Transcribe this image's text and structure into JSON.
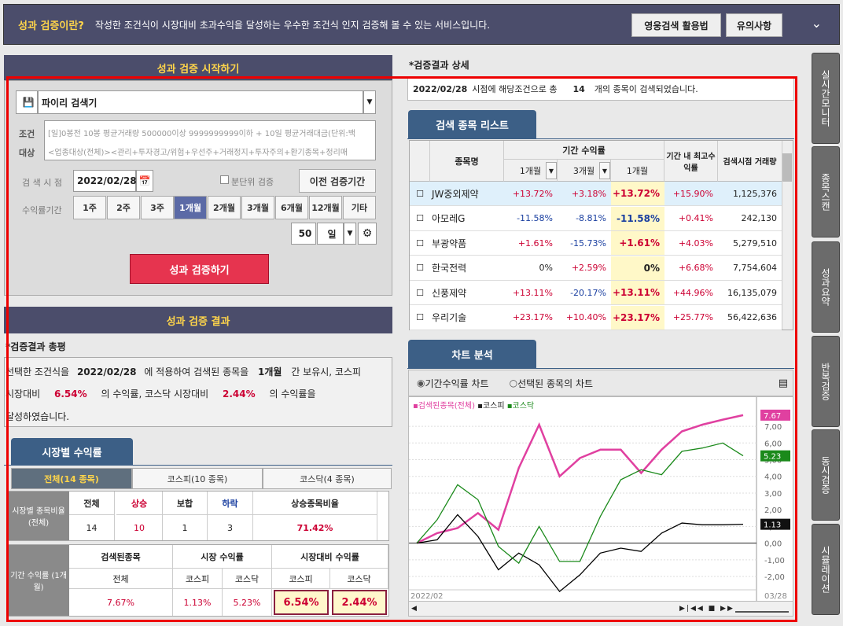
{
  "top": {
    "question": "성과 검증이란?",
    "desc": "작성한 조건식이 시장대비 초과수익을 달성하는 우수한 조건식 인지 검증해 볼 수 있는 서비스입니다.",
    "btn_guide": "영웅검색 활용법",
    "btn_notice": "유의사항"
  },
  "start": {
    "title": "성과 검증 시작하기",
    "search_name": "파이리 검색기",
    "cond_label": "조건",
    "cond_text": "[일]0봉전 10봉 평균거래량 500000이상 9999999999이하 + 10일 평균거래대금(단위:백",
    "target_label": "대상",
    "target_text": "<업종대상(전체)><관리+투자경고/위험+우선주+거래정지+투자주의+환기종목+정리매",
    "date_label": "검 색 시 점",
    "date": "2022/02/28",
    "minute_check": "분단위 검증",
    "prev_btn": "이전 검증기간",
    "period_label": "수익률기간",
    "periods": [
      "1주",
      "2주",
      "3주",
      "1개월",
      "2개월",
      "3개월",
      "6개월",
      "12개월",
      "기타"
    ],
    "days_val": "50",
    "days_unit": "일",
    "run_btn": "성과 검증하기"
  },
  "result": {
    "title": "성과 검증 결과",
    "summary_title": "*검증결과 총평",
    "line1a": "선택한 조건식을",
    "line1b": "2022/02/28",
    "line1c": "에 적용하여 검색된 종목을",
    "line1d": "1개월",
    "line1e": "간 보유시, 코스피",
    "line2a": "시장대비",
    "line2b": "6.54%",
    "line2c": "의 수익률, 코스닥 시장대비",
    "line2d": "2.44%",
    "line2e": "의 수익률을",
    "line3": "달성하였습니다."
  },
  "market": {
    "tab": "시장별 수익률",
    "subtabs": [
      "전체(14 종목)",
      "코스피(10 종목)",
      "코스닥(4 종목)"
    ],
    "ratio_label": "시장별 종목비율 (전체)",
    "ratio_heads": [
      "전체",
      "상승",
      "보합",
      "하락",
      "상승종목비율"
    ],
    "ratio_vals": [
      "14",
      "10",
      "1",
      "3",
      "71.42%"
    ],
    "ret_label": "기간 수익률 (1개월)",
    "ret_h1": [
      "검색된종목",
      "시장 수익률",
      "시장대비 수익률"
    ],
    "ret_h2": [
      "전체",
      "코스피",
      "코스닥",
      "코스피",
      "코스닥"
    ],
    "ret_vals": [
      "7.67%",
      "1.13%",
      "5.23%",
      "6.54%",
      "2.44%"
    ]
  },
  "detail": {
    "title": "*검증결과 상세",
    "date": "2022/02/28",
    "t1": "시점에 해당조건으로 총",
    "count": "14",
    "t2": "개의 종목이 검색되었습니다."
  },
  "list": {
    "tab": "검색 종목 리스트",
    "h_name": "종목명",
    "h_period": "기간 수익률",
    "h_max": "기간 내 최고수익률",
    "h_vol": "검색시점 거래량",
    "sub": [
      "1개월",
      "3개월",
      "1개월"
    ],
    "rows": [
      {
        "name": "JW중외제약",
        "a": "+13.72%",
        "b": "+3.18%",
        "c": "+13.72%",
        "d": "+15.90%",
        "v": "1,125,376"
      },
      {
        "name": "아모레G",
        "a": "-11.58%",
        "b": "-8.81%",
        "c": "-11.58%",
        "d": "+0.41%",
        "v": "242,130"
      },
      {
        "name": "부광약품",
        "a": "+1.61%",
        "b": "-15.73%",
        "c": "+1.61%",
        "d": "+4.03%",
        "v": "5,279,510"
      },
      {
        "name": "한국전력",
        "a": "0%",
        "b": "+2.59%",
        "c": "0%",
        "d": "+6.68%",
        "v": "7,754,604"
      },
      {
        "name": "신풍제약",
        "a": "+13.11%",
        "b": "-20.17%",
        "c": "+13.11%",
        "d": "+44.96%",
        "v": "16,135,079"
      },
      {
        "name": "우리기술",
        "a": "+23.17%",
        "b": "+10.40%",
        "c": "+23.17%",
        "d": "+25.77%",
        "v": "56,422,636"
      }
    ]
  },
  "chart": {
    "tab": "차트 분석",
    "radio1": "기간수익률 차트",
    "radio2": "선택된 종목의 차트",
    "legend": [
      "검색된종목(전체)",
      "코스피",
      "코스닥"
    ],
    "x_start": "2022/02",
    "x_end": "03/28",
    "ticks": [
      "7,00",
      "6,00",
      "5,00",
      "4,00",
      "3,00",
      "2,00",
      "1,00",
      "0,00",
      "-1,00",
      "-2,00"
    ],
    "labels": [
      "7.67",
      "5.23",
      "1.13"
    ]
  },
  "chart_data": {
    "type": "line",
    "ylim": [
      -2.8,
      7.9
    ],
    "series": [
      {
        "name": "검색된종목(전체)",
        "color": "#e040a0",
        "values": [
          0,
          0.6,
          0.9,
          1.8,
          0.8,
          4.5,
          7.1,
          4.0,
          5.1,
          5.6,
          5.6,
          4.2,
          5.6,
          6.7,
          7.1,
          7.4,
          7.67
        ]
      },
      {
        "name": "코스피",
        "color": "#000000",
        "values": [
          0,
          0.2,
          1.7,
          0.4,
          -1.6,
          -0.6,
          -1.3,
          -2.9,
          -1.9,
          -0.6,
          -0.3,
          -0.5,
          0.6,
          1.2,
          1.1,
          1.1,
          1.13
        ]
      },
      {
        "name": "코스닥",
        "color": "#1b8a1b",
        "values": [
          0,
          1.4,
          3.5,
          2.6,
          -0.2,
          -1.2,
          1.0,
          -1.1,
          -1.1,
          1.6,
          3.8,
          4.4,
          4.1,
          5.5,
          5.7,
          6.0,
          5.23
        ]
      }
    ]
  },
  "side": [
    "실시간모니터",
    "종목스캔",
    "성과요약",
    "반복검증",
    "동시검증",
    "시뮬레이션"
  ]
}
